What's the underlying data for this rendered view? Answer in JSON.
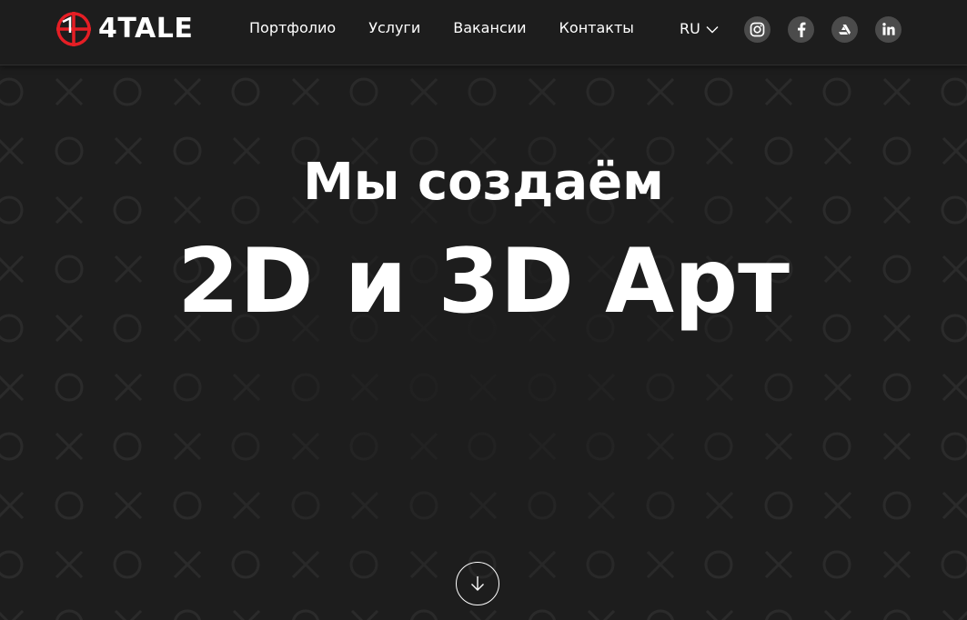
{
  "brand": {
    "logo_text": "4TALE",
    "accent_color": "#e51e25"
  },
  "nav": {
    "items": [
      {
        "label": "Портфолио"
      },
      {
        "label": "Услуги"
      },
      {
        "label": "Вакансии"
      },
      {
        "label": "Контакты"
      }
    ]
  },
  "language": {
    "current": "RU",
    "icon": "chevron-down-icon"
  },
  "socials": [
    {
      "name": "Instagram",
      "icon": "instagram-icon"
    },
    {
      "name": "Facebook",
      "icon": "facebook-icon"
    },
    {
      "name": "ArtStation",
      "icon": "artstation-icon"
    },
    {
      "name": "LinkedIn",
      "icon": "linkedin-icon"
    }
  ],
  "hero": {
    "subtitle": "Мы создаём",
    "title": "2D и 3D Арт",
    "scroll_icon": "arrow-down-icon"
  },
  "colors": {
    "background": "#1d1d1d",
    "pattern": "#2a2a2a",
    "social_circle": "#4b4b4b",
    "text": "#ffffff"
  }
}
